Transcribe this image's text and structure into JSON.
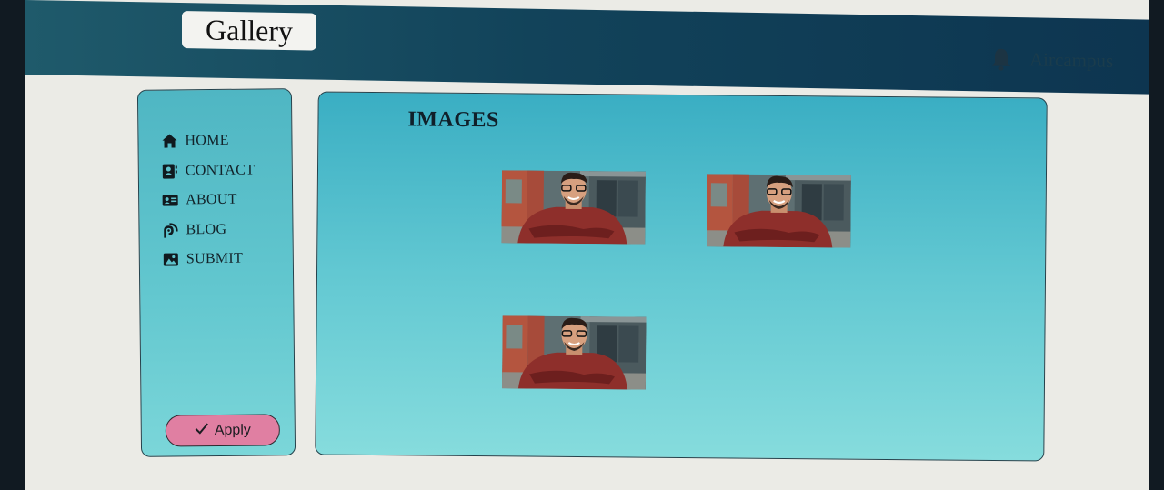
{
  "header": {
    "app_title": "Gallery",
    "user_name": "Aircampus",
    "bell_icon": "bell-icon"
  },
  "sidebar": {
    "items": [
      {
        "label": "HOME",
        "icon": "home-icon"
      },
      {
        "label": "CONTACT",
        "icon": "contact-card-icon"
      },
      {
        "label": "ABOUT",
        "icon": "id-card-icon"
      },
      {
        "label": "BLOG",
        "icon": "blog-feed-icon"
      },
      {
        "label": "SUBMIT",
        "icon": "image-icon"
      }
    ],
    "apply_label": "Apply",
    "apply_icon": "check-icon"
  },
  "main": {
    "heading": "IMAGES",
    "images": [
      {
        "subject": "smiling man with glasses, arms crossed"
      },
      {
        "subject": "smiling man with glasses, arms crossed"
      },
      {
        "subject": "smiling man with glasses, arms crossed"
      }
    ]
  },
  "colors": {
    "topbar": "#12435a",
    "panel": "#4fbfcc",
    "apply_button": "#e07fa2",
    "page_bg": "#ebebe6"
  }
}
